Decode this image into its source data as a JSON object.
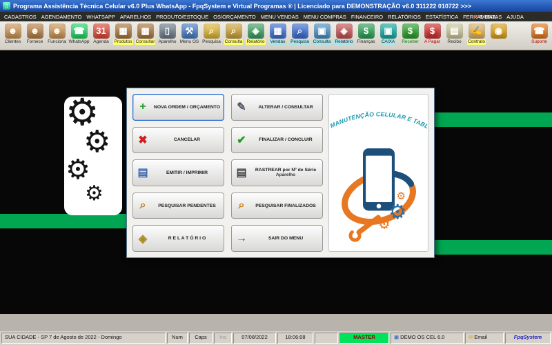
{
  "window": {
    "title": "Programa Assistência Técnica Celular v6.0 Plus WhatsApp - FpqSystem e Virtual Programas ® | Licenciado para DEMONSTRAÇÃO v6.0 311222 010722 >>>"
  },
  "menubar": {
    "items": [
      "CADASTROS",
      "AGENDAMENTO",
      "WHATSAPP",
      "APARELHOS",
      "PRODUTO/ESTOQUE",
      "OS/ORÇAMENTO",
      "MENU VENDAS",
      "MENU COMPRAS",
      "FINANCEIRO",
      "RELATÓRIOS",
      "ESTATÍSTICA",
      "FERRAMENTAS",
      "AJUDA"
    ],
    "email": {
      "label": "E-MAIL"
    }
  },
  "toolbar": {
    "buttons": [
      {
        "label": "Clientes",
        "glyph": "☻",
        "color": "#c99457"
      },
      {
        "label": "Fornece",
        "glyph": "☻",
        "color": "#b58048"
      },
      {
        "label": "Funciona",
        "glyph": "☻",
        "color": "#c99457"
      },
      {
        "label": "WhatsApp",
        "glyph": "☎",
        "color": "#25d366"
      },
      {
        "label": "Agenda",
        "glyph": "31",
        "color": "#d94a3a"
      },
      {
        "label": "Produtos",
        "glyph": "▦",
        "color": "#a9763d",
        "label_bg": "#ffff70"
      },
      {
        "label": "Consultar",
        "glyph": "▦",
        "color": "#a9763d",
        "label_bg": "#ffff70"
      },
      {
        "label": "Aparelho",
        "glyph": "▯",
        "color": "#6f7d8c"
      },
      {
        "label": "Menu OS",
        "glyph": "⚒",
        "color": "#4a7ec2"
      },
      {
        "label": "Pesquisa",
        "glyph": "⌕",
        "color": "#d9b33a"
      },
      {
        "label": "Consulta",
        "glyph": "⌕",
        "color": "#caa23c",
        "label_bg": "#ffff70"
      },
      {
        "label": "Relatório",
        "glyph": "◈",
        "color": "#3f9e5f",
        "label_bg": "#ffff70"
      },
      {
        "label": "Vendas",
        "glyph": "▦",
        "color": "#3f6fd0",
        "label_bg": "#a8e4ea"
      },
      {
        "label": "Pesquisa",
        "glyph": "⌕",
        "color": "#3f6fd0",
        "label_bg": "#a8e4ea"
      },
      {
        "label": "Consulta",
        "glyph": "▣",
        "color": "#4a90c2",
        "label_bg": "#a8e4ea"
      },
      {
        "label": "Relatório",
        "glyph": "◈",
        "color": "#c05555",
        "label_bg": "#a8e4ea"
      },
      {
        "label": "Finanças",
        "glyph": "$",
        "color": "#2f9e57"
      },
      {
        "label": "CAIXA",
        "glyph": "▣",
        "color": "#18a8a0",
        "label_bg": "#a8e4ea"
      },
      {
        "label": "Receber",
        "glyph": "$",
        "color": "#2f9e2f",
        "label_color": "#0a7a0a"
      },
      {
        "label": "A Pagar",
        "glyph": "$",
        "color": "#cc3333",
        "label_color": "#b00000"
      },
      {
        "label": "Recibo",
        "glyph": "▤",
        "color": "#c8c49a"
      },
      {
        "label": "Contrato",
        "glyph": "✍",
        "color": "#d8b06a",
        "label_bg": "#ffff70"
      },
      {
        "label": "",
        "glyph": "◉",
        "color": "#d8a020"
      },
      {
        "label": "Suporte",
        "glyph": "☎",
        "color": "#e07820",
        "label_color": "#b00000",
        "class": "push-right"
      }
    ]
  },
  "dialog": {
    "buttons": [
      {
        "label": "NOVA ORDEM / ORÇAMENTO",
        "sub": "",
        "glyph": "+",
        "color": "#1d9e1d",
        "class": "focused"
      },
      {
        "label": "ALTERAR / CONSULTAR",
        "sub": "",
        "glyph": "✎",
        "color": "#555566"
      },
      {
        "label": "CANCELAR",
        "sub": "",
        "glyph": "✖",
        "color": "#cc2222"
      },
      {
        "label": "FINALIZAR / CONCLUIR",
        "sub": "",
        "glyph": "✔",
        "color": "#1d9e1d"
      },
      {
        "label": "EMITIR / IMPRIMIR",
        "sub": "",
        "glyph": "▤",
        "color": "#3a66b0"
      },
      {
        "label": "RASTREAR por Nº de Série",
        "sub": "Aparelho",
        "glyph": "▤",
        "color": "#444444"
      },
      {
        "label": "PESQUISAR PENDENTES",
        "sub": "",
        "glyph": "⌕",
        "color": "#c07818"
      },
      {
        "label": "PESQUISAR FINALIZADOS",
        "sub": "",
        "glyph": "⌕",
        "color": "#c07818"
      },
      {
        "label": "R E L A T Ó R I O",
        "sub": "",
        "glyph": "◈",
        "color": "#b08820"
      },
      {
        "label": "SAIR DO MENU",
        "sub": "",
        "glyph": "→",
        "color": "#2a4fa0"
      }
    ]
  },
  "logo": {
    "arc_text": "MANUTENÇÃO CELULAR E TABLET"
  },
  "statusbar": {
    "location": "SUA CIDADE - SP  7 de Agosto de 2022 - Domingo",
    "num": "Num",
    "caps": "Caps",
    "ins": "Ins",
    "date": "07/08/2022",
    "time": "18:06:08",
    "master": "MASTER",
    "demo": "DEMO OS CEL 6.0",
    "email": "Email",
    "brand": "FpqSystem"
  },
  "colors": {
    "accent_green": "#00a651",
    "whatsapp_green": "#25d366",
    "master_bg": "#00e25a",
    "brand_blue": "#2020c0",
    "logo_teal": "#189aae",
    "phone_navy": "#1d4f7c",
    "swoosh_orange": "#e87722",
    "titlebar_blue": "#17459e"
  }
}
